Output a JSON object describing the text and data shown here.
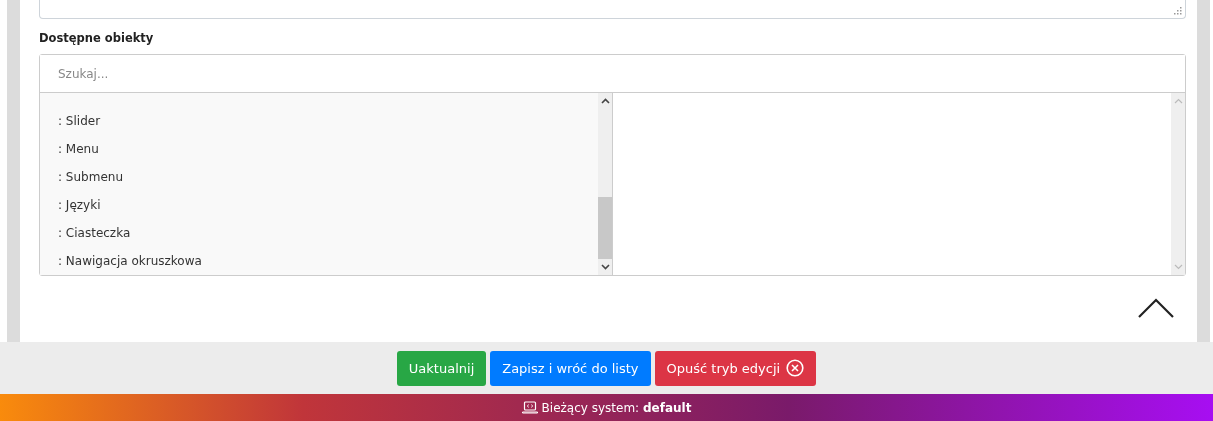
{
  "section_label": "Dostępne obiekty",
  "search": {
    "placeholder": "Szukaj..."
  },
  "available_items": [
    {
      "label": ": Slider"
    },
    {
      "label": ": Menu"
    },
    {
      "label": ": Submenu"
    },
    {
      "label": ": Języki"
    },
    {
      "label": ": Ciasteczka"
    },
    {
      "label": ": Nawigacja okruszkowa"
    }
  ],
  "buttons": [
    {
      "label": "Uaktualnij",
      "kind": "success"
    },
    {
      "label": "Zapisz i wróć do listy",
      "kind": "primary"
    },
    {
      "label": "Opuść tryb edycji",
      "kind": "danger"
    }
  ],
  "footer": {
    "prefix": "Bieżący system:",
    "system": "default"
  }
}
